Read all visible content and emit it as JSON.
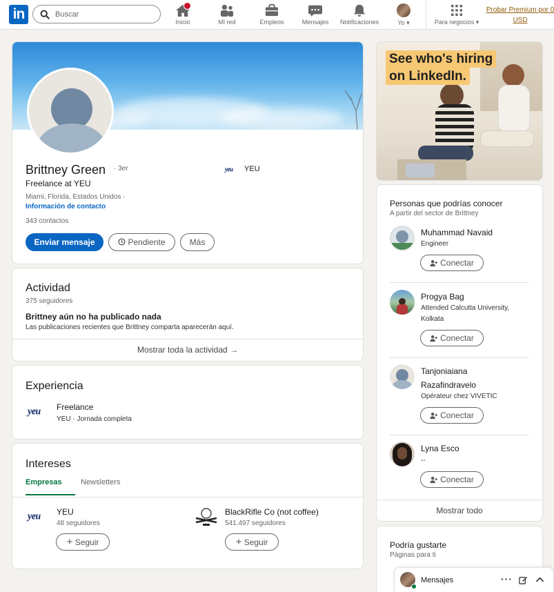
{
  "nav": {
    "search_placeholder": "Buscar",
    "items": [
      {
        "label": "Inicio",
        "icon": "home-icon",
        "has_badge": true
      },
      {
        "label": "Mi red",
        "icon": "people-icon"
      },
      {
        "label": "Empleos",
        "icon": "briefcase-icon"
      },
      {
        "label": "Mensajes",
        "icon": "chat-icon"
      },
      {
        "label": "Notificaciones",
        "icon": "bell-icon"
      },
      {
        "label": "Yo",
        "icon": "avatar"
      }
    ],
    "business_label": "Para negocios",
    "premium_line1": "Probar Premium por 0",
    "premium_line2": "USD"
  },
  "profile": {
    "name": "Brittney Green",
    "degree": "· 3er",
    "headline": "Freelance at YEU",
    "location": "Miami, Florida, Estados Unidos ·",
    "contact_link": "Información de contacto",
    "connections": "343 contactos",
    "company": "YEU",
    "company_logo_text": "yeu",
    "buttons": {
      "message": "Enviar mensaje",
      "pending": "Pendiente",
      "more": "Más"
    }
  },
  "activity": {
    "title": "Actividad",
    "followers": "375 seguidores",
    "empty_title": "Brittney aún no ha publicado nada",
    "empty_desc": "Las publicaciones recientes que Brittney comparta aparecerán aquí.",
    "show_all": "Mostrar toda la actividad →"
  },
  "experience": {
    "title": "Experiencia",
    "items": [
      {
        "role": "Freelance",
        "company": "YEU · Jornada completa",
        "logo_text": "yeu"
      }
    ]
  },
  "interests": {
    "title": "Intereses",
    "tabs": [
      "Empresas",
      "Newsletters"
    ],
    "active_tab": "Empresas",
    "items": [
      {
        "name": "YEU",
        "followers": "48 seguidores",
        "button": "Seguir",
        "logo_text": "yeu"
      },
      {
        "name": "BlackRifle Co (not coffee)",
        "followers": "541.497 seguidores",
        "button": "Seguir"
      }
    ]
  },
  "ad": {
    "line1": "See who's hiring",
    "line2": "on LinkedIn."
  },
  "pymk": {
    "title": "Personas que podrías conocer",
    "subtitle": "A partir del sector de Brittney",
    "people": [
      {
        "name": "Muhammad Navaid",
        "desc": "Engineer"
      },
      {
        "name": "Progya Bag",
        "desc1": "Attended Calcutta University,",
        "desc2": "Kolkata"
      },
      {
        "name1": "Tanjoniaiana",
        "name2": "Razafindravelo",
        "desc": "Opérateur chez VIVETIC"
      },
      {
        "name": "Lyna Esco",
        "desc": "--"
      }
    ],
    "connect_label": "Conectar",
    "show_all": "Mostrar todo"
  },
  "pages": {
    "title": "Podría gustarte",
    "subtitle": "Páginas para ti"
  },
  "messaging": {
    "label": "Mensajes"
  },
  "colors": {
    "brand": "#0a66c2",
    "accent_green": "#057642",
    "premium": "#915907",
    "badge": "#cb112d"
  }
}
